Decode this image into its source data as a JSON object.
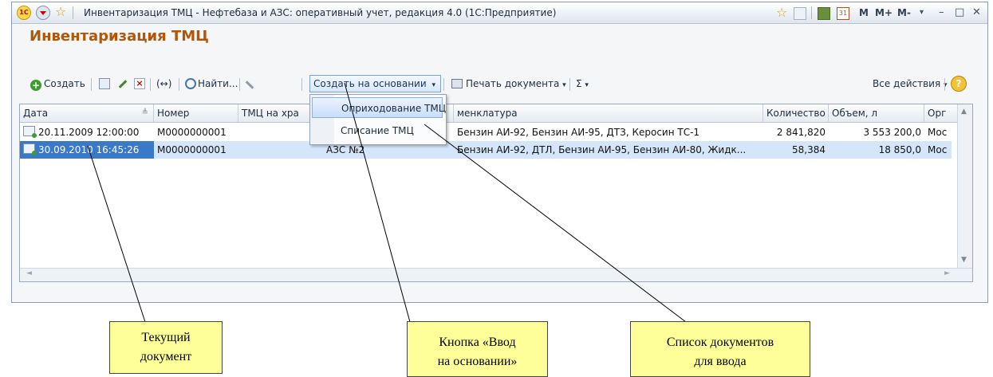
{
  "window": {
    "title": "Инвентаризация ТМЦ - Нефтебаза и АЗС: оперативный учет, редакция 4.0  (1С:Предприятие)",
    "logo_text": "1С",
    "right_controls": [
      "M",
      "M+",
      "M-",
      "–",
      "□",
      "✕"
    ]
  },
  "form": {
    "title": "Инвентаризация ТМЦ"
  },
  "toolbar": {
    "create_label": "Создать",
    "find_label": "Найти...",
    "change_mark": "(↔)",
    "create_basis_label": "Создать на основании",
    "print_label": "Печать документа",
    "sum_label": "Σ",
    "all_actions_label": "Все действия",
    "help_label": "?"
  },
  "grid": {
    "columns": [
      "Дата",
      "Номер",
      "ТМЦ на хра",
      "",
      "менклатура",
      "Количество",
      "Объем, л",
      "Орг"
    ],
    "rows": [
      {
        "date": "20.11.2009 12:00:00",
        "number": "M0000000001",
        "storage": "",
        "point": "",
        "nomenclature": "Бензин АИ-92, Бензин АИ-95, ДТЗ, Керосин ТС-1",
        "quantity": "2 841,820",
        "volume": "3 553 200,0",
        "org": "Мос",
        "selected": false
      },
      {
        "date": "30.09.2010 16:45:26",
        "number": "M0000000001",
        "storage": "",
        "point": "АЗС №2",
        "nomenclature": "Бензин АИ-92, ДТЛ, Бензин АИ-95, Бензин АИ-80, Жидк...",
        "quantity": "58,384",
        "volume": "18 850,0",
        "org": "Мос",
        "selected": true
      }
    ]
  },
  "dropdown": {
    "items": [
      "Оприходование ТМЦ",
      "Списание ТМЦ"
    ]
  },
  "callouts": {
    "current_doc": [
      "Текущий",
      "документ"
    ],
    "basis_button": [
      "Кнопка «Ввод",
      "на основании»"
    ],
    "doc_list": [
      "Список документов",
      "для ввода"
    ]
  },
  "colors": {
    "title_orange": "#b25606",
    "selection_blue": "#3a78c8",
    "callout_yellow": "#ffff99"
  }
}
